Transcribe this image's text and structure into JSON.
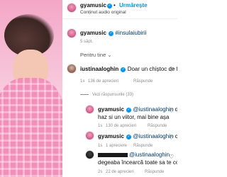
{
  "header": {
    "username": "gyamusic",
    "separator": "•",
    "follow_label": "Urmărește",
    "subtitle": "Conținut audio original"
  },
  "caption": {
    "username": "gyamusic",
    "text": "#insulaiubirii",
    "time": "5 săpt."
  },
  "section": {
    "label": "Pentru tine",
    "chevron": "⌄"
  },
  "comments": [
    {
      "username": "iustinaaloghin",
      "text": "Doar un chiștoc de femeie",
      "time": "1s",
      "likes": "136 de aprecieri",
      "reply_label": "Răspunde"
    }
  ],
  "view_replies": "Vezi răspunsurile (33)",
  "replies": [
    {
      "username": "gyamusic",
      "mention": "@iustinaaloghin",
      "text_line1": "da",
      "text_line2": "haz si un viitor, mai bine așa",
      "time": "1s",
      "likes": "130 de aprecieri",
      "reply_label": "Răspunde"
    },
    {
      "username": "gyamusic",
      "mention": "@iustinaaloghin",
      "text_line1": "ce",
      "time": "1s",
      "likes": "1 apreciere",
      "reply_label": "Răspunde"
    },
    {
      "username_redacted": true,
      "mention": "@iustinaaloghin",
      "text_line2": "degeaba încearcă toate sa te co",
      "time": "2s",
      "likes": "22 de aprecieri",
      "reply_label": "Răspunde"
    }
  ],
  "icons": {
    "heart": "♡",
    "verified": "✓"
  }
}
